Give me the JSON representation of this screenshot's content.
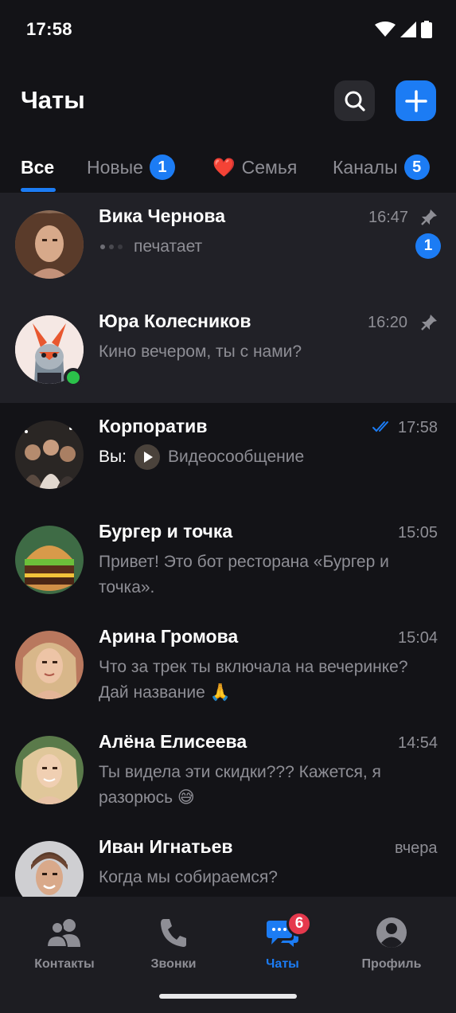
{
  "status": {
    "time": "17:58"
  },
  "header": {
    "title": "Чаты"
  },
  "tabs": [
    {
      "label": "Все",
      "badge": ""
    },
    {
      "label": "Новые",
      "badge": "1"
    },
    {
      "label": "Семья",
      "emoji": "❤️",
      "badge": ""
    },
    {
      "label": "Каналы",
      "badge": "5"
    }
  ],
  "chats": [
    {
      "name": "Вика Чернова",
      "time": "16:47",
      "preview": "печатает",
      "unread": "1",
      "pinned": true
    },
    {
      "name": "Юра Колесников",
      "time": "16:20",
      "preview": "Кино вечером, ты с нами?",
      "pinned": true,
      "online": true
    },
    {
      "name": "Корпоратив",
      "time": "17:58",
      "you": "Вы:",
      "preview": "Видеосообщение",
      "read": true
    },
    {
      "name": "Бургер и точка",
      "time": "15:05",
      "preview": "Привет! Это бот ресторана «Бургер и точка»."
    },
    {
      "name": "Арина Громова",
      "time": "15:04",
      "preview": "Что за трек ты включала на вечеринке? Дай название 🙏"
    },
    {
      "name": "Алёна Елисеева",
      "time": "14:54",
      "preview": "Ты видела эти скидки??? Кажется, я разорюсь 😅"
    },
    {
      "name": "Иван Игнатьев",
      "time": "вчера",
      "preview": "Когда мы собираемся?"
    }
  ],
  "nav": {
    "contacts": "Контакты",
    "calls": "Звонки",
    "chats": "Чаты",
    "chats_badge": "6",
    "profile": "Профиль"
  },
  "colors": {
    "accent": "#1c7cf4",
    "online": "#2bc24a",
    "badge_red": "#e5394d"
  }
}
